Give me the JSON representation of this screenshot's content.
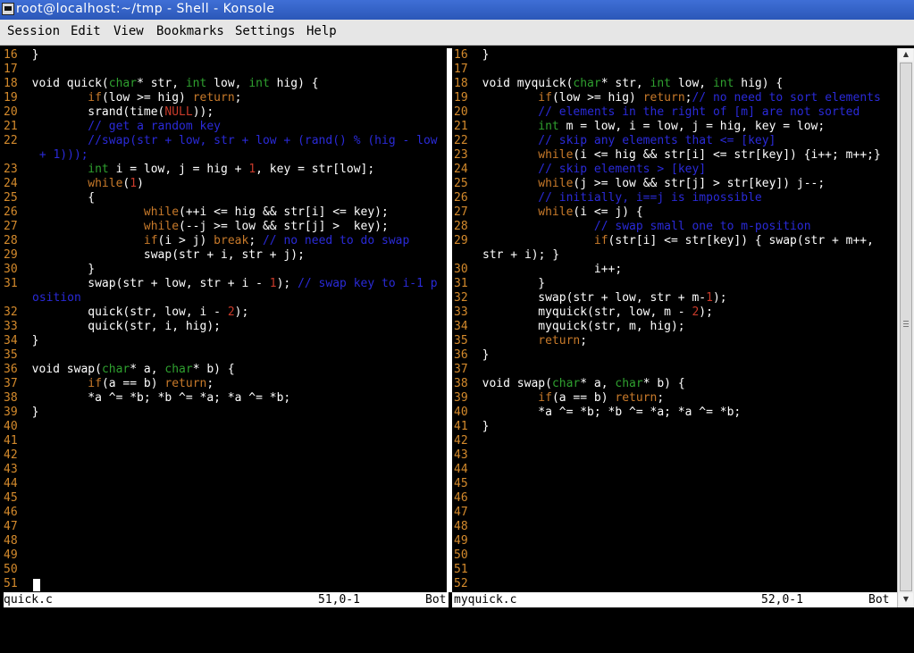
{
  "window": {
    "title": "root@localhost:~/tmp - Shell - Konsole",
    "buttons": [
      "",
      "",
      ""
    ]
  },
  "menubar": {
    "items": [
      "Session",
      "Edit",
      "View",
      "Bookmarks",
      "Settings",
      "Help"
    ]
  },
  "colors": {
    "line_numbers": "#d48a2c",
    "keyword": "#c87a2a",
    "type": "#2fa02f",
    "comment": "#2a2ad8",
    "number": "#c83a2a",
    "text": "#ffffff",
    "background": "#000000",
    "titlebar": "#3161c7"
  },
  "left_pane": {
    "filename": "quick.c",
    "position": "51,0-1",
    "scroll": "Bot",
    "lines": [
      {
        "n": "16",
        "tokens": [
          [
            "t",
            "}"
          ]
        ]
      },
      {
        "n": "17",
        "tokens": []
      },
      {
        "n": "18",
        "tokens": [
          [
            "t",
            "void quick("
          ],
          [
            "ty",
            "char"
          ],
          [
            "t",
            "* str, "
          ],
          [
            "ty",
            "int"
          ],
          [
            "t",
            " low, "
          ],
          [
            "ty",
            "int"
          ],
          [
            "t",
            " hig) {"
          ]
        ]
      },
      {
        "n": "19",
        "tokens": [
          [
            "t",
            "        "
          ],
          [
            "kw",
            "if"
          ],
          [
            "t",
            "(low >= hig) "
          ],
          [
            "kw",
            "return"
          ],
          [
            "t",
            ";"
          ]
        ]
      },
      {
        "n": "20",
        "tokens": [
          [
            "t",
            "        srand(time("
          ],
          [
            "n",
            "NULL"
          ],
          [
            "t",
            "));"
          ]
        ]
      },
      {
        "n": "21",
        "tokens": [
          [
            "t",
            "        "
          ],
          [
            "c",
            "// get a random key"
          ]
        ]
      },
      {
        "n": "22",
        "tokens": [
          [
            "t",
            "        "
          ],
          [
            "c",
            "//swap(str + low, str + low + (rand() % (hig - low"
          ]
        ]
      },
      {
        "n": "",
        "tokens": [
          [
            "t",
            " "
          ],
          [
            "c",
            "+ 1)));"
          ]
        ]
      },
      {
        "n": "23",
        "tokens": [
          [
            "t",
            "        "
          ],
          [
            "ty",
            "int"
          ],
          [
            "t",
            " i = low, j = hig + "
          ],
          [
            "n",
            "1"
          ],
          [
            "t",
            ", key = str[low];"
          ]
        ]
      },
      {
        "n": "24",
        "tokens": [
          [
            "t",
            "        "
          ],
          [
            "kw",
            "while"
          ],
          [
            "t",
            "("
          ],
          [
            "n",
            "1"
          ],
          [
            "t",
            ")"
          ]
        ]
      },
      {
        "n": "25",
        "tokens": [
          [
            "t",
            "        {"
          ]
        ]
      },
      {
        "n": "26",
        "tokens": [
          [
            "t",
            "                "
          ],
          [
            "kw",
            "while"
          ],
          [
            "t",
            "(++i <= hig && str[i] <= key);"
          ]
        ]
      },
      {
        "n": "27",
        "tokens": [
          [
            "t",
            "                "
          ],
          [
            "kw",
            "while"
          ],
          [
            "t",
            "(--j >= low && str[j] >  key);"
          ]
        ]
      },
      {
        "n": "28",
        "tokens": [
          [
            "t",
            "                "
          ],
          [
            "kw",
            "if"
          ],
          [
            "t",
            "(i > j) "
          ],
          [
            "kw",
            "break"
          ],
          [
            "t",
            "; "
          ],
          [
            "c",
            "// no need to do swap"
          ]
        ]
      },
      {
        "n": "29",
        "tokens": [
          [
            "t",
            "                swap(str + i, str + j);"
          ]
        ]
      },
      {
        "n": "30",
        "tokens": [
          [
            "t",
            "        }"
          ]
        ]
      },
      {
        "n": "31",
        "tokens": [
          [
            "t",
            "        swap(str + low, str + i - "
          ],
          [
            "n",
            "1"
          ],
          [
            "t",
            "); "
          ],
          [
            "c",
            "// swap key to i-1 p"
          ]
        ]
      },
      {
        "n": "",
        "tokens": [
          [
            "c",
            "osition"
          ]
        ]
      },
      {
        "n": "32",
        "tokens": [
          [
            "t",
            "        quick(str, low, i - "
          ],
          [
            "n",
            "2"
          ],
          [
            "t",
            ");"
          ]
        ]
      },
      {
        "n": "33",
        "tokens": [
          [
            "t",
            "        quick(str, i, hig);"
          ]
        ]
      },
      {
        "n": "34",
        "tokens": [
          [
            "t",
            "}"
          ]
        ]
      },
      {
        "n": "35",
        "tokens": []
      },
      {
        "n": "36",
        "tokens": [
          [
            "t",
            "void swap("
          ],
          [
            "ty",
            "char"
          ],
          [
            "t",
            "* a, "
          ],
          [
            "ty",
            "char"
          ],
          [
            "t",
            "* b) {"
          ]
        ]
      },
      {
        "n": "37",
        "tokens": [
          [
            "t",
            "        "
          ],
          [
            "kw",
            "if"
          ],
          [
            "t",
            "(a == b) "
          ],
          [
            "kw",
            "return"
          ],
          [
            "t",
            ";"
          ]
        ]
      },
      {
        "n": "38",
        "tokens": [
          [
            "t",
            "        *a ^= *b; *b ^= *a; *a ^= *b;"
          ]
        ]
      },
      {
        "n": "39",
        "tokens": [
          [
            "t",
            "}"
          ]
        ]
      },
      {
        "n": "40",
        "tokens": []
      },
      {
        "n": "41",
        "tokens": []
      },
      {
        "n": "42",
        "tokens": []
      },
      {
        "n": "43",
        "tokens": []
      },
      {
        "n": "44",
        "tokens": []
      },
      {
        "n": "45",
        "tokens": []
      },
      {
        "n": "46",
        "tokens": []
      },
      {
        "n": "47",
        "tokens": []
      },
      {
        "n": "48",
        "tokens": []
      },
      {
        "n": "49",
        "tokens": []
      },
      {
        "n": "50",
        "tokens": []
      },
      {
        "n": "51",
        "tokens": []
      }
    ]
  },
  "right_pane": {
    "filename": "myquick.c",
    "position": "52,0-1",
    "scroll": "Bot",
    "lines": [
      {
        "n": "16",
        "tokens": [
          [
            "t",
            "}"
          ]
        ]
      },
      {
        "n": "17",
        "tokens": []
      },
      {
        "n": "18",
        "tokens": [
          [
            "t",
            "void myquick("
          ],
          [
            "ty",
            "char"
          ],
          [
            "t",
            "* str, "
          ],
          [
            "ty",
            "int"
          ],
          [
            "t",
            " low, "
          ],
          [
            "ty",
            "int"
          ],
          [
            "t",
            " hig) {"
          ]
        ]
      },
      {
        "n": "19",
        "tokens": [
          [
            "t",
            "        "
          ],
          [
            "kw",
            "if"
          ],
          [
            "t",
            "(low >= hig) "
          ],
          [
            "kw",
            "return"
          ],
          [
            "t",
            ";"
          ],
          [
            "c",
            "// no need to sort elements"
          ]
        ]
      },
      {
        "n": "20",
        "tokens": [
          [
            "t",
            "        "
          ],
          [
            "c",
            "// elements in the right of [m] are not sorted"
          ]
        ]
      },
      {
        "n": "21",
        "tokens": [
          [
            "t",
            "        "
          ],
          [
            "ty",
            "int"
          ],
          [
            "t",
            " m = low, i = low, j = hig, key = low;"
          ]
        ]
      },
      {
        "n": "22",
        "tokens": [
          [
            "t",
            "        "
          ],
          [
            "c",
            "// skip any elements that <= [key]"
          ]
        ]
      },
      {
        "n": "23",
        "tokens": [
          [
            "t",
            "        "
          ],
          [
            "kw",
            "while"
          ],
          [
            "t",
            "(i <= hig && str[i] <= str[key]) {i++; m++;}"
          ]
        ]
      },
      {
        "n": "24",
        "tokens": [
          [
            "t",
            "        "
          ],
          [
            "c",
            "// skip elements > [key]"
          ]
        ]
      },
      {
        "n": "25",
        "tokens": [
          [
            "t",
            "        "
          ],
          [
            "kw",
            "while"
          ],
          [
            "t",
            "(j >= low && str[j] > str[key]) j--;"
          ]
        ]
      },
      {
        "n": "26",
        "tokens": [
          [
            "t",
            "        "
          ],
          [
            "c",
            "// initially, i==j is impossible"
          ]
        ]
      },
      {
        "n": "27",
        "tokens": [
          [
            "t",
            "        "
          ],
          [
            "kw",
            "while"
          ],
          [
            "t",
            "(i <= j) {"
          ]
        ]
      },
      {
        "n": "28",
        "tokens": [
          [
            "t",
            "                "
          ],
          [
            "c",
            "// swap small one to m-position"
          ]
        ]
      },
      {
        "n": "29",
        "tokens": [
          [
            "t",
            "                "
          ],
          [
            "kw",
            "if"
          ],
          [
            "t",
            "(str[i] <= str[key]) { swap(str + m++,"
          ]
        ]
      },
      {
        "n": "",
        "tokens": [
          [
            "t",
            "str + i); }"
          ]
        ]
      },
      {
        "n": "30",
        "tokens": [
          [
            "t",
            "                i++;"
          ]
        ]
      },
      {
        "n": "31",
        "tokens": [
          [
            "t",
            "        }"
          ]
        ]
      },
      {
        "n": "32",
        "tokens": [
          [
            "t",
            "        swap(str + low, str + m-"
          ],
          [
            "n",
            "1"
          ],
          [
            "t",
            ");"
          ]
        ]
      },
      {
        "n": "33",
        "tokens": [
          [
            "t",
            "        myquick(str, low, m - "
          ],
          [
            "n",
            "2"
          ],
          [
            "t",
            ");"
          ]
        ]
      },
      {
        "n": "34",
        "tokens": [
          [
            "t",
            "        myquick(str, m, hig);"
          ]
        ]
      },
      {
        "n": "35",
        "tokens": [
          [
            "t",
            "        "
          ],
          [
            "kw",
            "return"
          ],
          [
            "t",
            ";"
          ]
        ]
      },
      {
        "n": "36",
        "tokens": [
          [
            "t",
            "}"
          ]
        ]
      },
      {
        "n": "37",
        "tokens": []
      },
      {
        "n": "38",
        "tokens": [
          [
            "t",
            "void swap("
          ],
          [
            "ty",
            "char"
          ],
          [
            "t",
            "* a, "
          ],
          [
            "ty",
            "char"
          ],
          [
            "t",
            "* b) {"
          ]
        ]
      },
      {
        "n": "39",
        "tokens": [
          [
            "t",
            "        "
          ],
          [
            "kw",
            "if"
          ],
          [
            "t",
            "(a == b) "
          ],
          [
            "kw",
            "return"
          ],
          [
            "t",
            ";"
          ]
        ]
      },
      {
        "n": "40",
        "tokens": [
          [
            "t",
            "        *a ^= *b; *b ^= *a; *a ^= *b;"
          ]
        ]
      },
      {
        "n": "41",
        "tokens": [
          [
            "t",
            "}"
          ]
        ]
      },
      {
        "n": "42",
        "tokens": []
      },
      {
        "n": "43",
        "tokens": []
      },
      {
        "n": "44",
        "tokens": []
      },
      {
        "n": "45",
        "tokens": []
      },
      {
        "n": "46",
        "tokens": []
      },
      {
        "n": "47",
        "tokens": []
      },
      {
        "n": "48",
        "tokens": []
      },
      {
        "n": "49",
        "tokens": []
      },
      {
        "n": "50",
        "tokens": []
      },
      {
        "n": "51",
        "tokens": []
      },
      {
        "n": "52",
        "tokens": []
      }
    ]
  }
}
